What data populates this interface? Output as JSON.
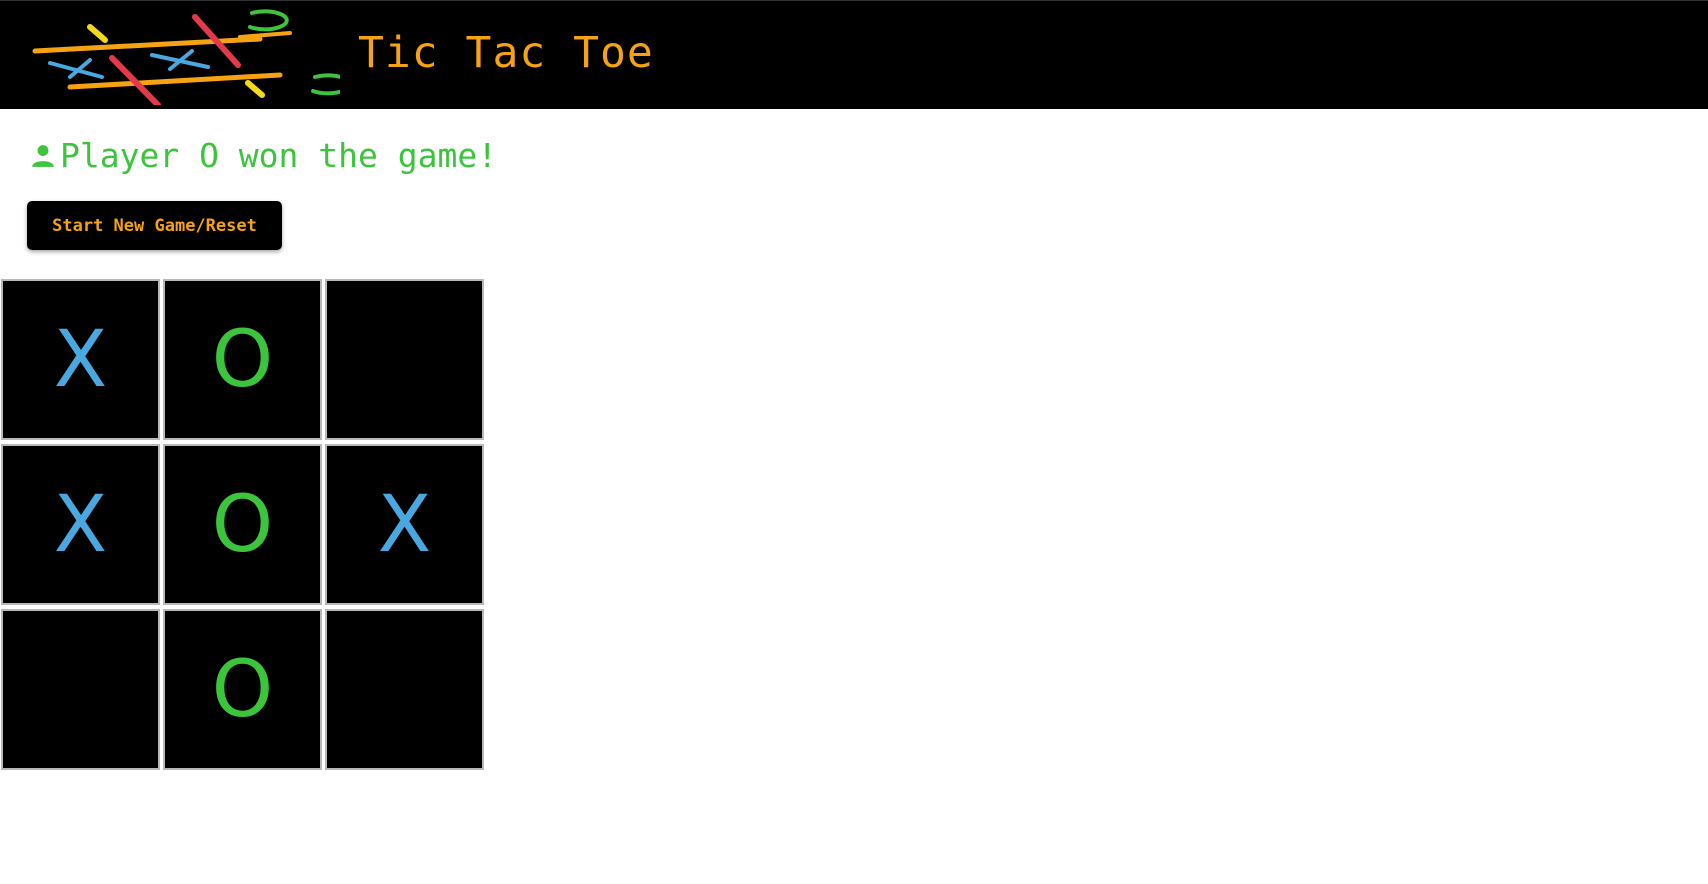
{
  "app": {
    "title": "Tic Tac Toe",
    "title_color": "#f5a213",
    "header_bg": "#000000"
  },
  "status": {
    "icon": "user-icon",
    "text": "Player O won the game!",
    "color": "#3cc43c"
  },
  "reset_button": {
    "label": "Start New Game/Reset",
    "text_color": "#f5a213"
  },
  "colors": {
    "x": "#4aa8e0",
    "o": "#3cc43c"
  },
  "board": {
    "cells": [
      "X",
      "O",
      "",
      "X",
      "O",
      "X",
      "",
      "O",
      ""
    ]
  }
}
